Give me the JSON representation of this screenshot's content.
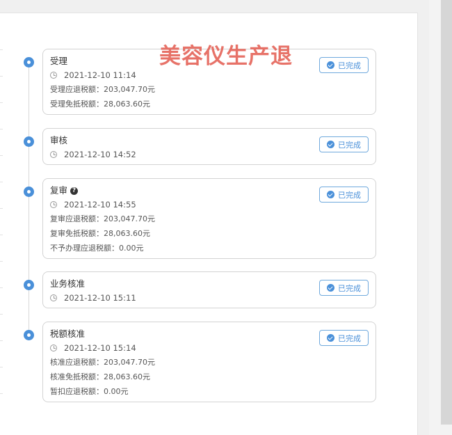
{
  "watermark": "美容仪生产退",
  "status_label": "已完成",
  "steps": [
    {
      "title": "受理",
      "time": "2021-12-10 11:14",
      "details": [
        "受理应退税额：203,047.70元",
        "受理免抵税额：28,063.60元"
      ]
    },
    {
      "title": "审核",
      "time": "2021-12-10 14:52",
      "details": []
    },
    {
      "title": "复审",
      "help_icon": "question-circle-icon",
      "time": "2021-12-10 14:55",
      "details": [
        "复审应退税额：203,047.70元",
        "复审免抵税额：28,063.60元",
        "不予办理应退税额：0.00元"
      ]
    },
    {
      "title": "业务核准",
      "time": "2021-12-10 15:11",
      "details": []
    },
    {
      "title": "税额核准",
      "time": "2021-12-10 15:14",
      "details": [
        "核准应退税额：203,047.70元",
        "核准免抵税额：28,063.60元",
        "暂扣应退税额：0.00元"
      ]
    }
  ],
  "colors": {
    "accent": "#4a90d9",
    "watermark": "#e35a4e"
  }
}
